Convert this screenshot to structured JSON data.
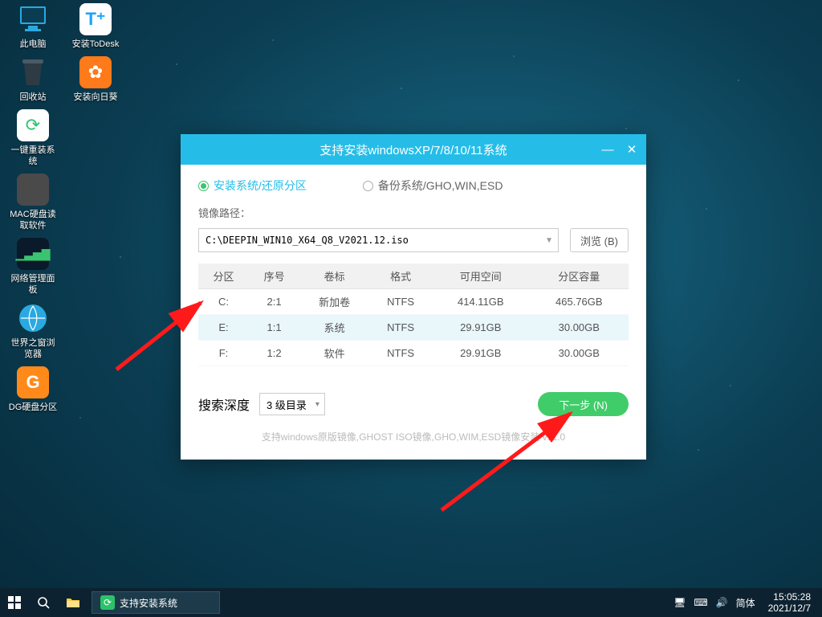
{
  "desktop_icons": [
    {
      "name": "此电脑",
      "kind": "pc"
    },
    {
      "name": "安装ToDesk",
      "kind": "todesk"
    },
    {
      "name": "回收站",
      "kind": "trash"
    },
    {
      "name": "安装向日葵",
      "kind": "sunflower"
    },
    {
      "name": "一键重装系统",
      "kind": "reinstall"
    },
    {
      "name": "",
      "kind": "spacer"
    },
    {
      "name": "MAC硬盘读取软件",
      "kind": "macdisk"
    },
    {
      "name": "",
      "kind": "spacer"
    },
    {
      "name": "网络管理面板",
      "kind": "netpanel"
    },
    {
      "name": "",
      "kind": "spacer"
    },
    {
      "name": "世界之窗浏览器",
      "kind": "browser"
    },
    {
      "name": "",
      "kind": "spacer"
    },
    {
      "name": "DG硬盘分区",
      "kind": "dgpart"
    }
  ],
  "window": {
    "title": "支持安装windowsXP/7/8/10/11系统",
    "radio_install": "安装系统/还原分区",
    "radio_backup": "备份系统/GHO,WIN,ESD",
    "image_path_label": "镜像路径：",
    "image_path_value": "C:\\DEEPIN_WIN10_X64_Q8_V2021.12.iso",
    "browse": "浏览 (B)",
    "cols": [
      "分区",
      "序号",
      "卷标",
      "格式",
      "可用空间",
      "分区容量"
    ],
    "rows": [
      {
        "drive": "C:",
        "idx": "2:1",
        "label": "新加卷",
        "fs": "NTFS",
        "free": "414.11GB",
        "total": "465.76GB",
        "selected": false
      },
      {
        "drive": "E:",
        "idx": "1:1",
        "label": "系统",
        "fs": "NTFS",
        "free": "29.91GB",
        "total": "30.00GB",
        "selected": true
      },
      {
        "drive": "F:",
        "idx": "1:2",
        "label": "软件",
        "fs": "NTFS",
        "free": "29.91GB",
        "total": "30.00GB",
        "selected": false
      }
    ],
    "depth_label": "搜索深度",
    "depth_value": "3 级目录",
    "next": "下一步 (N)",
    "hint": "支持windows原版镜像,GHOST ISO镜像,GHO,WIM,ESD镜像安装 v11.0"
  },
  "taskbar": {
    "app_label": "支持安装系统",
    "ime": "简体",
    "time": "15:05:28",
    "date": "2021/12/7"
  }
}
